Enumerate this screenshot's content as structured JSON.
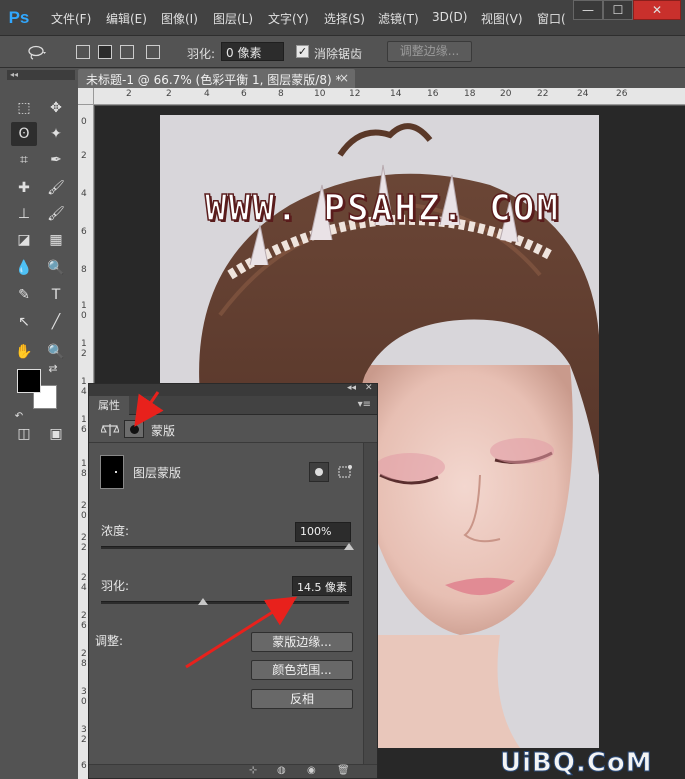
{
  "menubar": {
    "logo": "Ps",
    "items": [
      "文件(F)",
      "编辑(E)",
      "图像(I)",
      "图层(L)",
      "文字(Y)",
      "选择(S)",
      "滤镜(T)",
      "3D(D)",
      "视图(V)",
      "窗口("
    ],
    "window_controls": [
      "—",
      "☐",
      "✕"
    ]
  },
  "options": {
    "feather_label": "羽化:",
    "feather_value": "0 像素",
    "antialias_label": "消除锯齿",
    "antialias_checked": "✓",
    "refine_edge_label": "调整边缘..."
  },
  "toolbox": {
    "head": "◂◂",
    "tools": [
      "⬚",
      "✥",
      "ʘ",
      "✦",
      "⌗",
      "✒",
      "✚",
      "🖌",
      "⊥",
      "🖌",
      "◪",
      "▦",
      "💧",
      "🔍",
      "✎",
      "T",
      "↖",
      "╱",
      "✋",
      "🔍",
      "↶",
      "⇄",
      "◫",
      "▣"
    ]
  },
  "document": {
    "tab_title": "未标题-1 @ 66.7% (色彩平衡 1, 图层蒙版/8) *",
    "tab_close": "×",
    "ruler_top": [
      "2",
      "2",
      "4",
      "6",
      "8",
      "10",
      "12",
      "14",
      "16",
      "18",
      "20",
      "22",
      "24",
      "26"
    ],
    "ruler_left": [
      "0",
      "2",
      "4",
      "6",
      "8",
      "1 0",
      "1 2",
      "1 4",
      "1 6",
      "1 8",
      "2 0",
      "2 2",
      "2 4",
      "2 6",
      "2 8",
      "3 0",
      "3 2",
      "6"
    ],
    "watermark": "WWW. PSAHZ. COM",
    "corner_watermark": "UiBQ.CoM"
  },
  "panel": {
    "collapse": "◂◂",
    "close": "✕",
    "tab": "属性",
    "menu": "▾≡",
    "mask_section_label": "蒙版",
    "layer_mask_label": "图层蒙版",
    "density_label": "浓度:",
    "density_value": "100%",
    "density_level_percent": 100,
    "feather_label": "羽化:",
    "feather_value": "14.5 像素",
    "feather_level_percent": 41,
    "adjust_label": "调整:",
    "btn_mask_edge": "蒙版边缘...",
    "btn_color_range": "颜色范围...",
    "btn_invert": "反相",
    "bottom_icons": [
      "⊹",
      "◍",
      "◉",
      "🗑"
    ]
  },
  "colors": {
    "accent_blue": "#31a8ff",
    "annotation_red": "#e8211c",
    "canvas_bg": "#d9d7db"
  }
}
